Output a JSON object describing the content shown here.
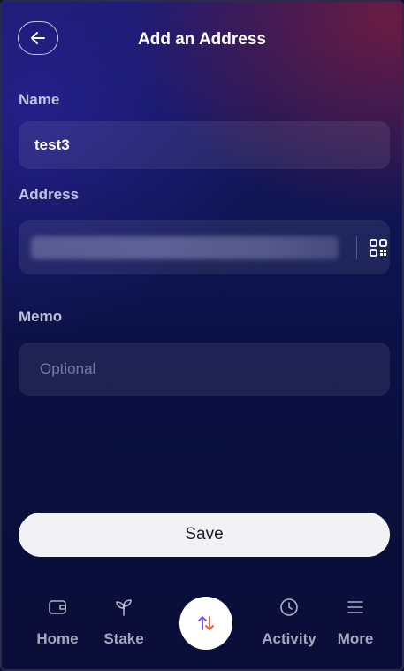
{
  "header": {
    "title": "Add an Address",
    "back_icon": "arrow-left-icon"
  },
  "form": {
    "name": {
      "label": "Name",
      "value": "test3"
    },
    "address": {
      "label": "Address",
      "qr_icon": "qr-code-icon"
    },
    "memo": {
      "label": "Memo",
      "placeholder": "Optional"
    }
  },
  "save_label": "Save",
  "nav": {
    "items": [
      {
        "label": "Home",
        "icon": "wallet-icon"
      },
      {
        "label": "Stake",
        "icon": "sprout-icon"
      },
      {
        "label": "Activity",
        "icon": "clock-icon"
      },
      {
        "label": "More",
        "icon": "menu-icon"
      }
    ],
    "center_icon": "swap-arrows-icon"
  },
  "colors": {
    "accent_up": "#e0683f",
    "accent_down": "#7b5cff",
    "button_bg": "#f2f2f5"
  }
}
